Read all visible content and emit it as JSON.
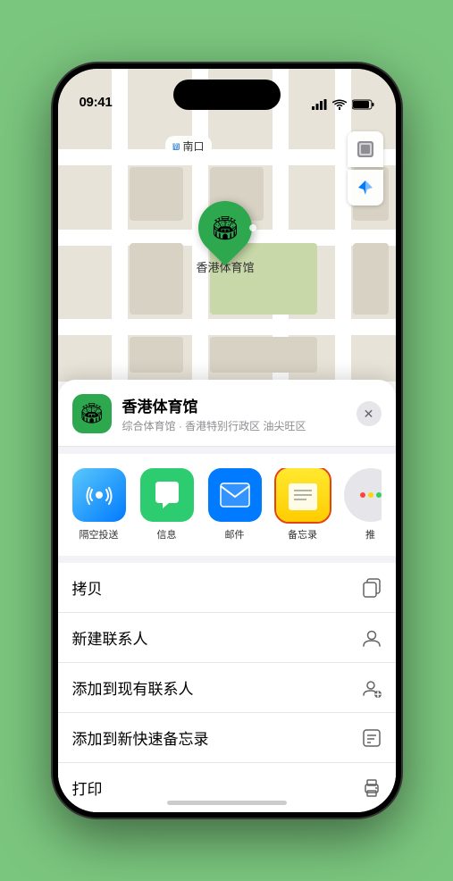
{
  "status_bar": {
    "time": "09:41",
    "signal_bars": "▌▌▌",
    "wifi": "WiFi",
    "battery": "Battery"
  },
  "map": {
    "label_text": "南口",
    "pin_label": "香港体育馆",
    "pin_emoji": "🏟"
  },
  "map_controls": {
    "layers_icon": "🗺",
    "location_icon": "➤"
  },
  "venue": {
    "name": "香港体育馆",
    "description": "综合体育馆 · 香港特别行政区 油尖旺区",
    "icon_emoji": "🏟"
  },
  "share_apps": [
    {
      "id": "airdrop",
      "label": "隔空投送",
      "type": "airdrop"
    },
    {
      "id": "messages",
      "label": "信息",
      "type": "messages"
    },
    {
      "id": "mail",
      "label": "邮件",
      "type": "mail"
    },
    {
      "id": "notes",
      "label": "备忘录",
      "type": "notes",
      "highlighted": true
    }
  ],
  "more_dots": [
    {
      "color": "#ff453a"
    },
    {
      "color": "#ffd60a"
    },
    {
      "color": "#30d158"
    }
  ],
  "actions": [
    {
      "id": "copy",
      "label": "拷贝",
      "icon": "⧉"
    },
    {
      "id": "new-contact",
      "label": "新建联系人",
      "icon": "👤"
    },
    {
      "id": "add-existing",
      "label": "添加到现有联系人",
      "icon": "👤"
    },
    {
      "id": "add-notes",
      "label": "添加到新快速备忘录",
      "icon": "🖊"
    },
    {
      "id": "print",
      "label": "打印",
      "icon": "🖨"
    }
  ],
  "close_btn_label": "✕",
  "home_indicator": true
}
